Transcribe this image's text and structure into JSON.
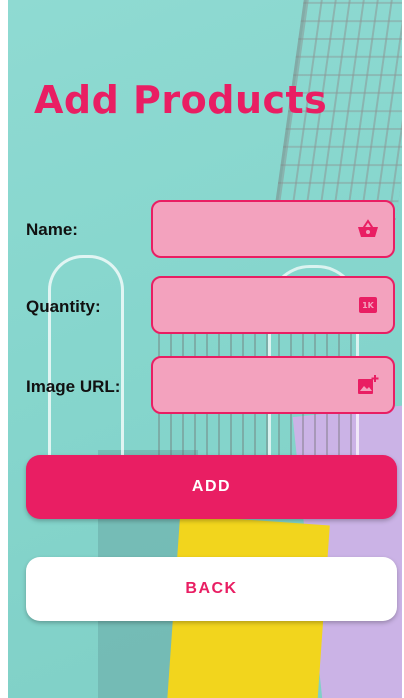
{
  "title": "Add Products",
  "form": {
    "name": {
      "label": "Name:",
      "value": "",
      "placeholder": "",
      "icon": "shopping-basket-icon"
    },
    "quantity": {
      "label": "Quantity:",
      "value": "",
      "placeholder": "",
      "icon": "1k-badge-icon",
      "icon_text": "1K"
    },
    "image_url": {
      "label": "Image URL:",
      "value": "",
      "placeholder": "",
      "icon": "add-photo-icon"
    }
  },
  "buttons": {
    "add_label": "ADD",
    "back_label": "BACK"
  },
  "colors": {
    "accent": "#e91e63",
    "field_fill": "#f3a2be",
    "background": "#8fdad2"
  }
}
